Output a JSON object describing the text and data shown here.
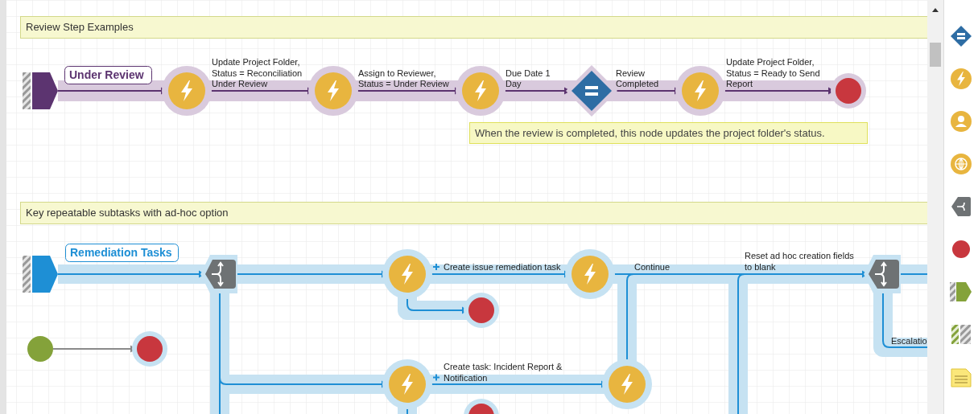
{
  "sections": [
    {
      "banner": "Review Step Examples",
      "lane": {
        "label": "Under Review",
        "color": "#5c3470",
        "nodes": [
          {
            "kind": "start"
          },
          {
            "kind": "trigger"
          },
          {
            "kind": "trigger"
          },
          {
            "kind": "trigger"
          },
          {
            "kind": "decision"
          },
          {
            "kind": "trigger"
          },
          {
            "kind": "end"
          }
        ],
        "edge_labels": [
          {
            "lines": [
              "Update Project Folder,",
              "Status = Reconciliation",
              "Under Review"
            ],
            "adhoc": false
          },
          {
            "lines": [
              "Assign to Reviewer,",
              "Status = Under Review"
            ],
            "adhoc": false
          },
          {
            "lines": [
              "Due Date 1",
              "Day"
            ],
            "adhoc": false
          },
          {
            "lines": [
              "Review",
              "Completed"
            ],
            "adhoc": false
          },
          {
            "lines": [
              "Update Project Folder,",
              "Status = Ready to Send",
              "Report"
            ],
            "adhoc": false
          }
        ],
        "note": "When the review is completed, this node updates the project folder's status."
      }
    },
    {
      "banner": "Key repeatable subtasks with ad-hoc option",
      "lane": {
        "label": "Remediation Tasks",
        "color": "#1e8fd5",
        "nodes": [
          {
            "kind": "start"
          },
          {
            "kind": "split"
          },
          {
            "kind": "trigger"
          },
          {
            "kind": "end"
          },
          {
            "kind": "trigger"
          },
          {
            "kind": "end"
          },
          {
            "kind": "trigger"
          },
          {
            "kind": "trigger"
          },
          {
            "kind": "split"
          },
          {
            "kind": "begin"
          },
          {
            "kind": "end"
          }
        ],
        "edge_labels": [
          {
            "lines": [
              "Create issue remediation task"
            ],
            "adhoc": true
          },
          {
            "lines": [
              "Continue"
            ],
            "adhoc": false
          },
          {
            "lines": [
              "Reset ad hoc creation fields",
              "to blank"
            ],
            "adhoc": false
          },
          {
            "lines": [
              "Create task: Incident Report &",
              "Notification"
            ],
            "adhoc": true
          },
          {
            "lines": [
              "Escalatio"
            ],
            "adhoc": false
          }
        ]
      }
    }
  ],
  "palette": [
    {
      "kind": "decision"
    },
    {
      "kind": "trigger"
    },
    {
      "kind": "person"
    },
    {
      "kind": "web"
    },
    {
      "kind": "split"
    },
    {
      "kind": "end"
    },
    {
      "kind": "start"
    },
    {
      "kind": "lane"
    },
    {
      "kind": "note"
    }
  ]
}
